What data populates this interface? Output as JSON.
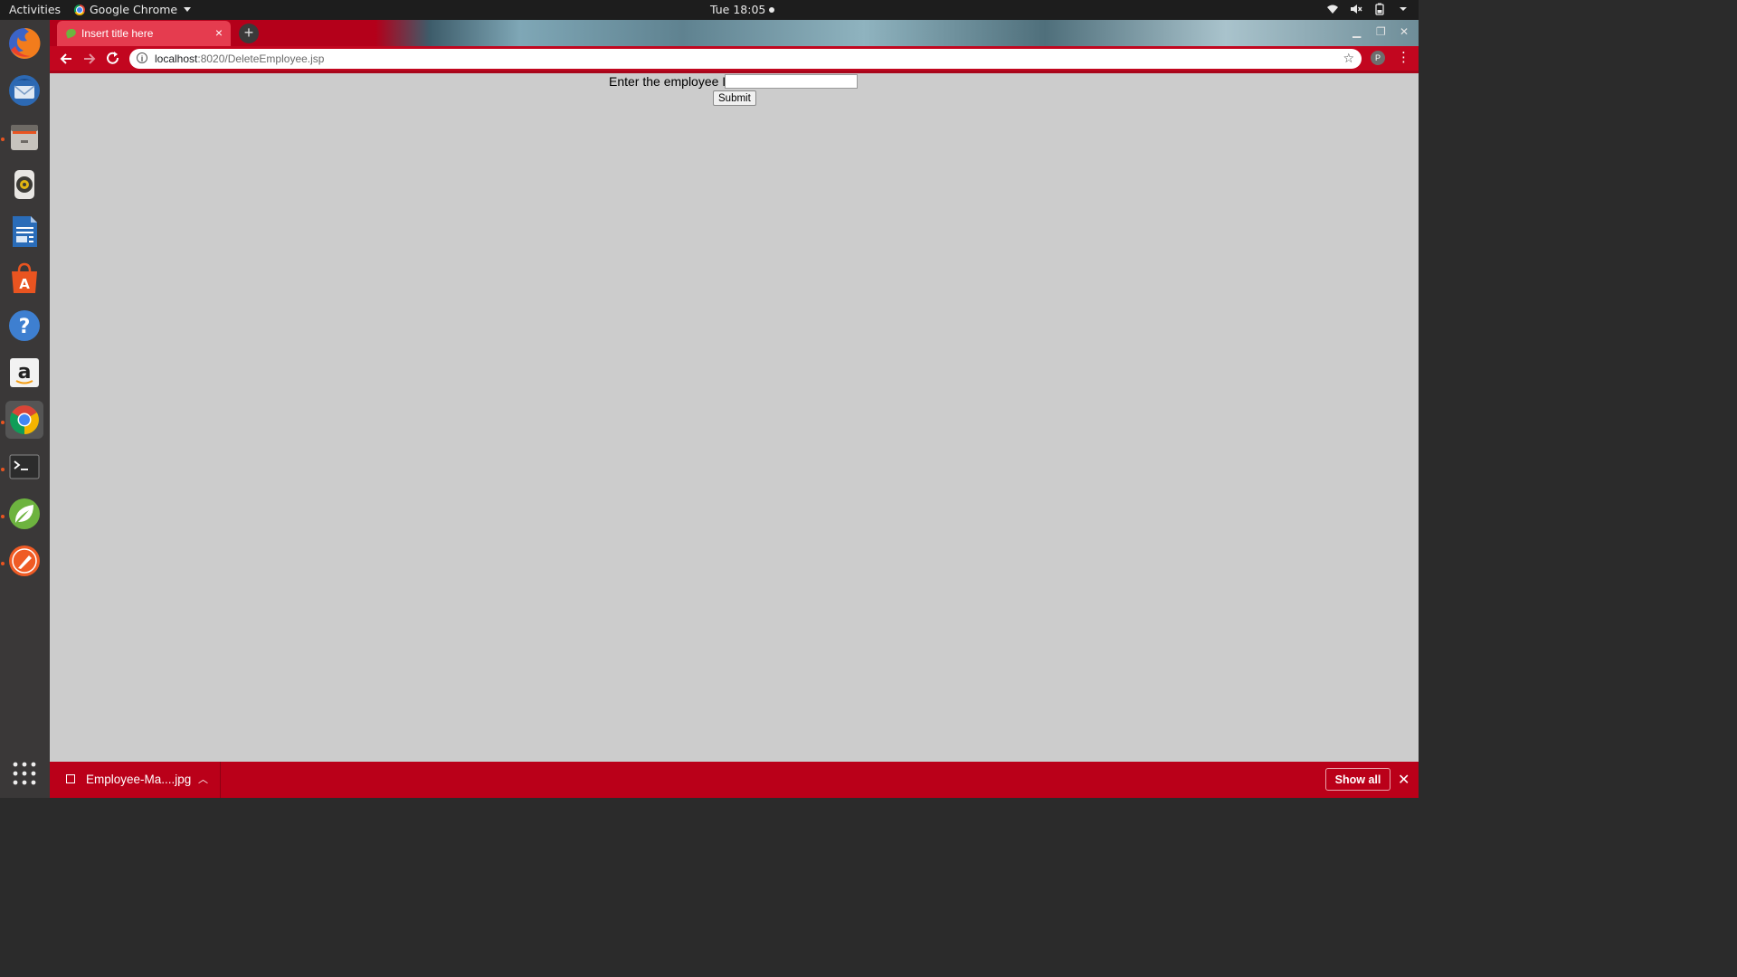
{
  "system": {
    "activities": "Activities",
    "app_name": "Google Chrome",
    "clock": "Tue 18:05",
    "tray_icons": [
      "wifi-icon",
      "volume-muted-icon",
      "battery-icon",
      "system-menu-caret-icon"
    ]
  },
  "dock": {
    "items": [
      {
        "name": "firefox",
        "running": false
      },
      {
        "name": "thunderbird",
        "running": false
      },
      {
        "name": "files",
        "running": true
      },
      {
        "name": "rhythmbox",
        "running": false
      },
      {
        "name": "libreoffice-writer",
        "running": false
      },
      {
        "name": "ubuntu-software",
        "running": false
      },
      {
        "name": "help",
        "running": false
      },
      {
        "name": "amazon",
        "running": false
      },
      {
        "name": "google-chrome",
        "running": true,
        "active": true
      },
      {
        "name": "terminal",
        "running": true
      },
      {
        "name": "spring-tool-suite",
        "running": true
      },
      {
        "name": "postman",
        "running": true
      }
    ],
    "show_apps": "show-applications-icon"
  },
  "browser": {
    "tab_title": "Insert title here",
    "url_host": "localhost",
    "url_rest": ":8020/DeleteEmployee.jsp",
    "profile_initial": "P",
    "accent_color": "#c2061f"
  },
  "form": {
    "label": "Enter the employee Id",
    "input_value": "",
    "submit_label": "Submit"
  },
  "downloads": {
    "file_name": "Employee-Ma....jpg",
    "show_all_label": "Show all"
  }
}
